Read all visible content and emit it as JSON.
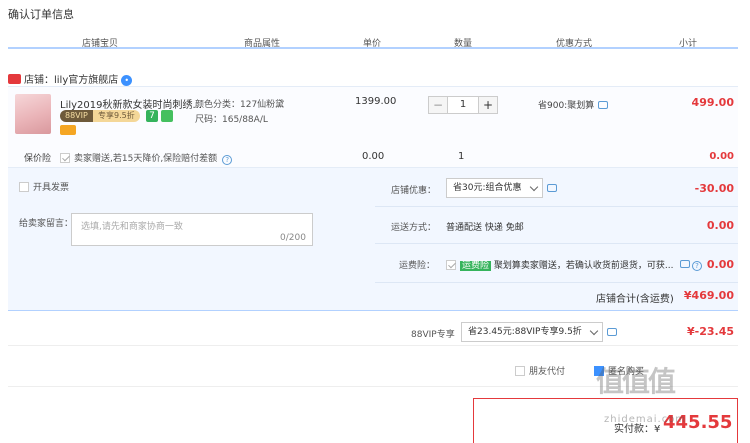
{
  "page_title": "确认订单信息",
  "columns": [
    "店铺宝贝",
    "商品属性",
    "单价",
    "数量",
    "优惠方式",
    "小计"
  ],
  "shop": {
    "label": "店铺：",
    "name": "lily官方旗舰店"
  },
  "item": {
    "name": "Lily2019秋新款女装时尚刺绣...",
    "vip_badge": "88VIP",
    "vip_discount": "专享9.5折",
    "seven_days": "7",
    "attr_color": "颜色分类：127仙粉黛",
    "attr_size": "尺码：165/88A/L",
    "price": "1399.00",
    "quantity": "1",
    "promo": "省900:聚划算",
    "subtotal": "499.00"
  },
  "insurance": {
    "label": "保价险",
    "desc": "卖家赠送,若15天降价,保险赔付差额",
    "price": "0.00",
    "qty": "1",
    "subtotal": "0.00"
  },
  "invoice_label": "开具发票",
  "message": {
    "label": "给卖家留言：",
    "placeholder": "选填,请先和商家协商一致",
    "count": "0/200"
  },
  "shop_discount": {
    "label": "店铺优惠：",
    "selected": "省30元:组合优惠",
    "amount": "-30.00"
  },
  "shipping": {
    "label": "运送方式：",
    "desc": "普通配送 快递 免邮",
    "amount": "0.00"
  },
  "shipping_insurance": {
    "label": "运费险：",
    "tag": "运费险",
    "desc": "聚划算卖家赠送，若确认收货前退货，可获...",
    "amount": "0.00"
  },
  "shop_total": {
    "label": "店铺合计(含运费)",
    "amount": "¥469.00"
  },
  "vip": {
    "label": "88VIP专享",
    "selected": "省23.45元:88VIP专享9.5折",
    "amount": "¥-23.45"
  },
  "friend_pay": "朋友代付",
  "anon_buy": "匿名购买",
  "total_partial": "实付款：¥",
  "total": "445.55",
  "watermark": {
    "main": "值值值",
    "sub": "zhidemai.com"
  },
  "colors": {
    "accent_red": "#e4393c",
    "line_blue": "#b2d1ff",
    "panel_blue": "#f2f7ff"
  }
}
